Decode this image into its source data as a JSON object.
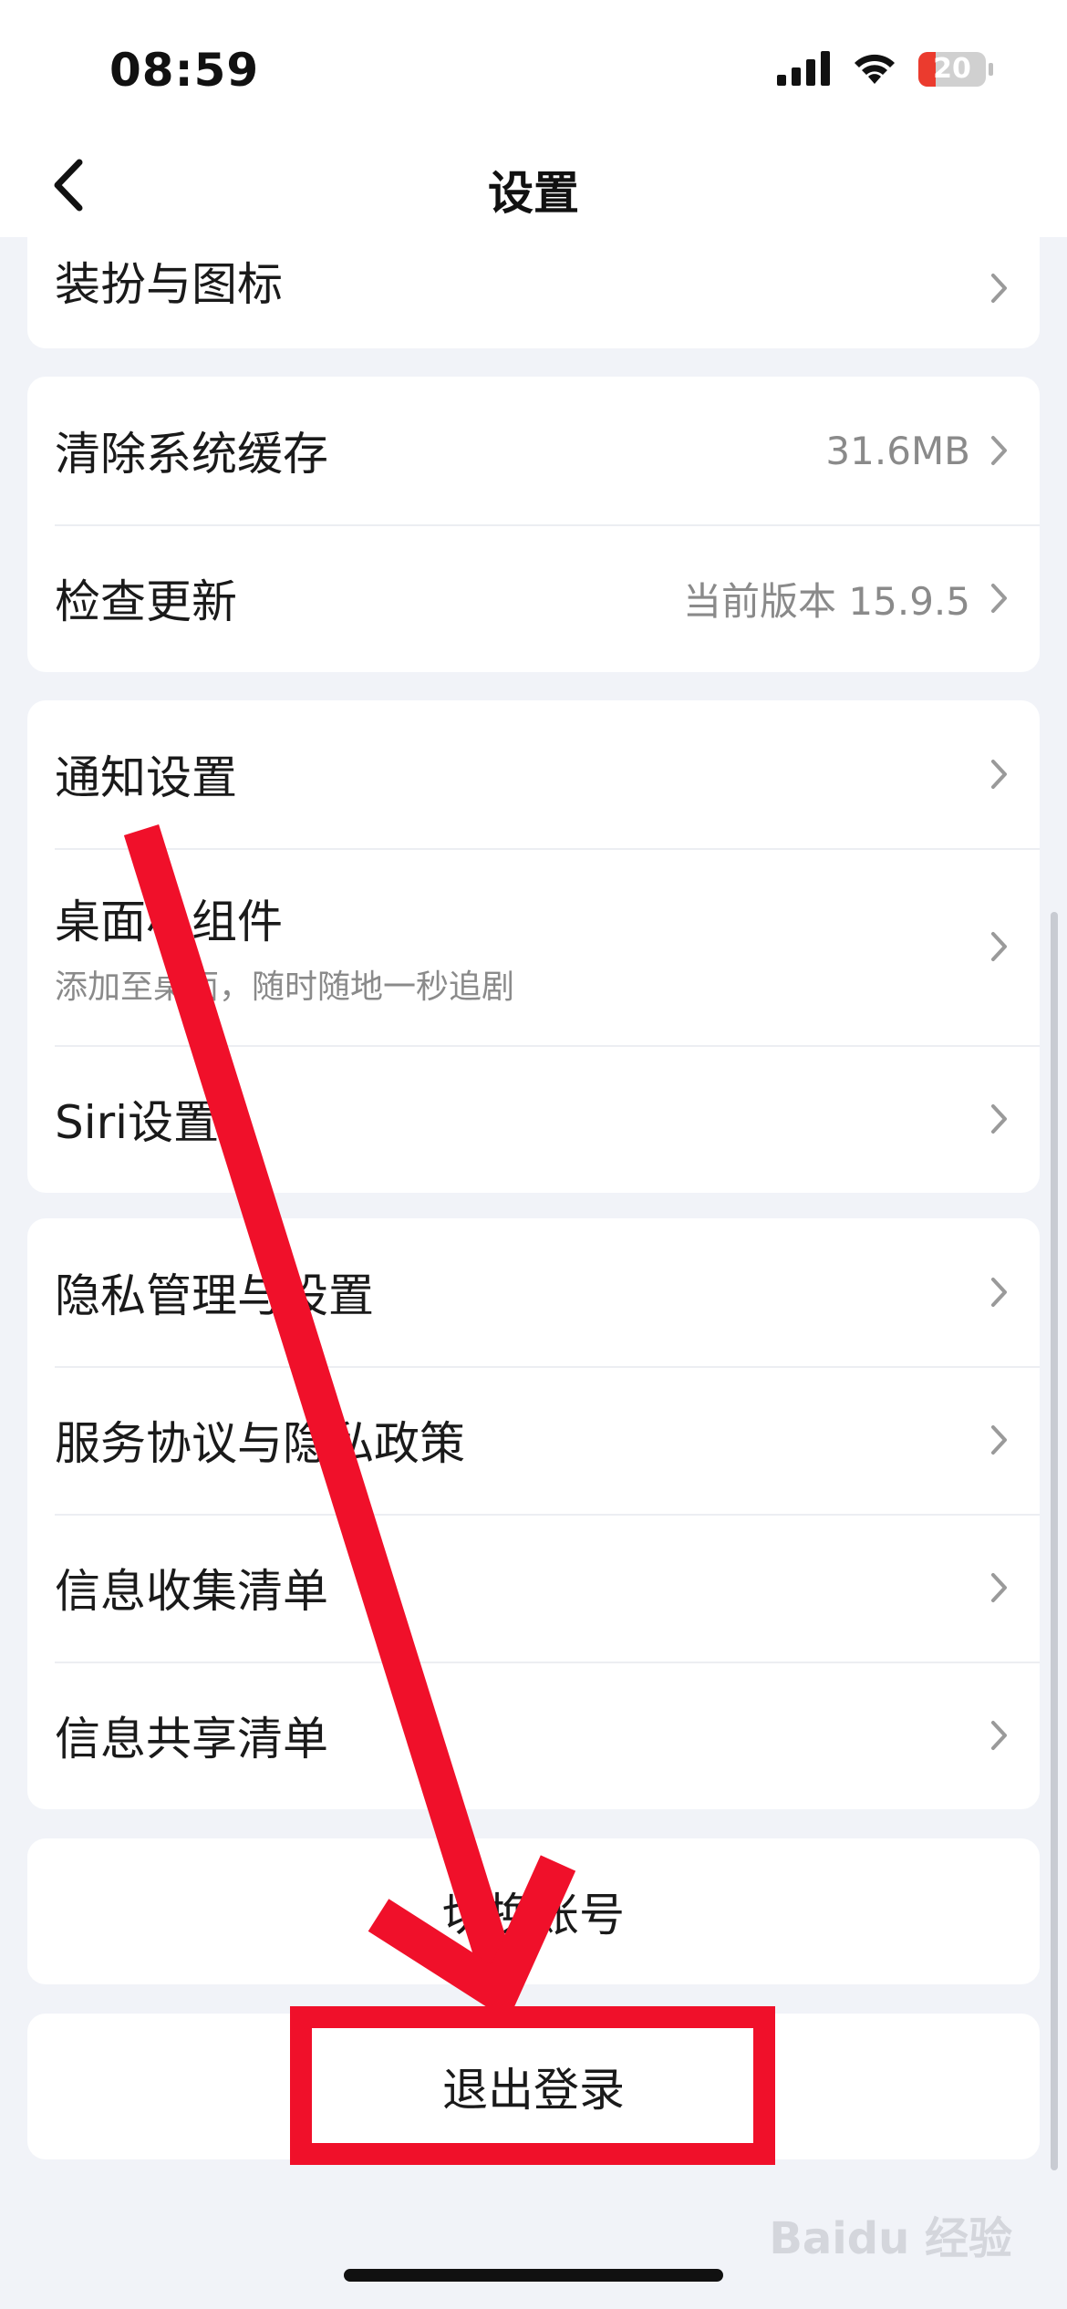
{
  "status_bar": {
    "time": "08:59",
    "battery": "20",
    "icons": [
      "cellular-signal-icon",
      "wifi-icon",
      "battery-icon"
    ]
  },
  "nav": {
    "title": "设置",
    "back_icon": "chevron-left-icon"
  },
  "card_appearance": {
    "items": [
      {
        "label": "装扮与图标"
      }
    ]
  },
  "card_system": {
    "items": [
      {
        "label": "清除系统缓存",
        "value": "31.6MB"
      },
      {
        "label": "检查更新",
        "value": "当前版本 15.9.5"
      }
    ]
  },
  "card_notify": {
    "items": [
      {
        "label": "通知设置"
      },
      {
        "label": "桌面小组件",
        "sub": "添加至桌面，随时随地一秒追剧"
      },
      {
        "label": "Siri设置"
      }
    ]
  },
  "card_privacy": {
    "items": [
      {
        "label": "隐私管理与设置"
      },
      {
        "label": "服务协议与隐私政策"
      },
      {
        "label": "信息收集清单"
      },
      {
        "label": "信息共享清单"
      }
    ]
  },
  "switch_account": {
    "label": "切换账号"
  },
  "logout": {
    "label": "退出登录"
  },
  "watermark": {
    "text": "Baidu 经验"
  },
  "colors": {
    "annotation": "#F0102A",
    "background": "#F1F3F8",
    "card": "#FFFFFF",
    "secondary_text": "#8A8A8A"
  }
}
